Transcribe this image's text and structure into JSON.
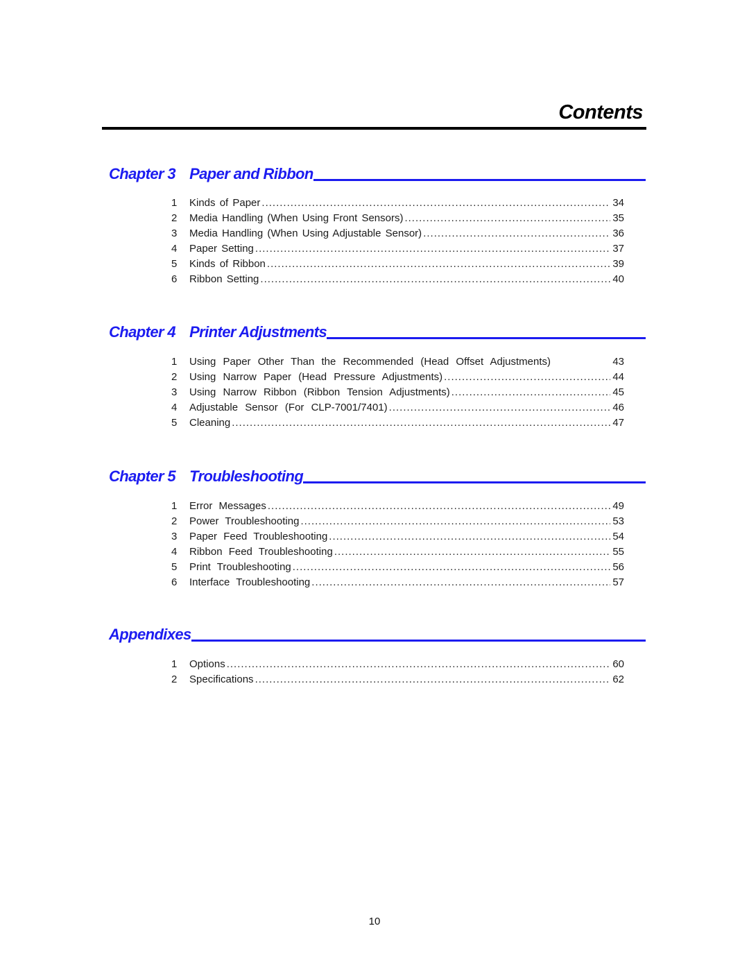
{
  "page": {
    "title": "Contents",
    "page_number": "10",
    "accent_color": "#1c1cf0"
  },
  "sections": [
    {
      "label": "Chapter 3",
      "title": "Paper and Ribbon",
      "entries": [
        {
          "num": "1",
          "text": "Kinds of Paper",
          "page": "34"
        },
        {
          "num": "2",
          "text": "Media Handling (When Using Front Sensors)",
          "page": "35"
        },
        {
          "num": "3",
          "text": "Media Handling (When Using Adjustable Sensor)",
          "page": "36"
        },
        {
          "num": "4",
          "text": "Paper Setting",
          "page": "37"
        },
        {
          "num": "5",
          "text": "Kinds of Ribbon",
          "page": "39"
        },
        {
          "num": "6",
          "text": "Ribbon Setting",
          "page": "40"
        }
      ]
    },
    {
      "label": "Chapter 4",
      "title": "Printer Adjustments",
      "entries": [
        {
          "num": "1",
          "text": "Using Paper Other Than the Recommended (Head Offset Adjustments)",
          "page": "43"
        },
        {
          "num": "2",
          "text": "Using Narrow Paper (Head Pressure Adjustments)",
          "page": "44"
        },
        {
          "num": "3",
          "text": "Using Narrow Ribbon (Ribbon Tension Adjustments)",
          "page": "45"
        },
        {
          "num": "4",
          "text": "Adjustable Sensor (For CLP-7001/7401)",
          "page": "46"
        },
        {
          "num": "5",
          "text": "Cleaning",
          "page": "47"
        }
      ]
    },
    {
      "label": "Chapter 5",
      "title": "Troubleshooting",
      "entries": [
        {
          "num": "1",
          "text": "Error Messages",
          "page": "49"
        },
        {
          "num": "2",
          "text": "Power Troubleshooting",
          "page": "53"
        },
        {
          "num": "3",
          "text": "Paper Feed Troubleshooting",
          "page": "54"
        },
        {
          "num": "4",
          "text": "Ribbon Feed Troubleshooting",
          "page": "55"
        },
        {
          "num": "5",
          "text": "Print Troubleshooting",
          "page": "56"
        },
        {
          "num": "6",
          "text": "Interface Troubleshooting",
          "page": "57"
        }
      ]
    },
    {
      "label": "Appendixes",
      "title": "",
      "entries": [
        {
          "num": "1",
          "text": "Options",
          "page": "60"
        },
        {
          "num": "2",
          "text": "Specifications",
          "page": "62"
        }
      ]
    }
  ]
}
